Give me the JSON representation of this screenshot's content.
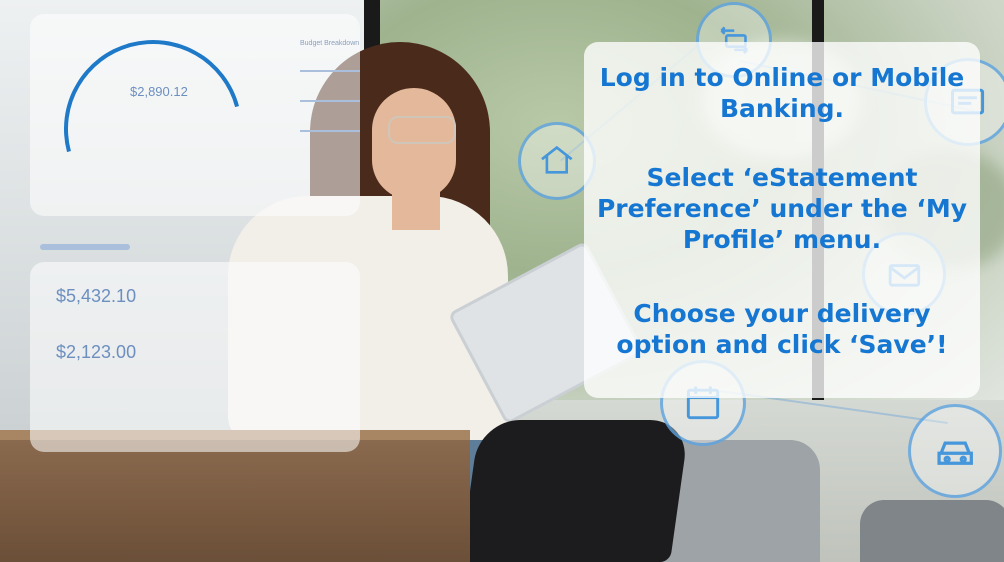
{
  "ui_overlay": {
    "balance_main": "$2,890.12",
    "balance_1": "$5,432.10",
    "balance_2": "$2,123.00",
    "budget_label": "Budget Breakdown"
  },
  "instructions": {
    "step1": "Log in to Online or Mobile Banking.",
    "step2": "Select ‘eStatement Preference’ under the ‘My Profile’ menu.",
    "step3": "Choose your delivery option and click ‘Save’!"
  },
  "colors": {
    "accent_blue": "#1677d2",
    "icon_ring": "#4696dc"
  },
  "icons": [
    "transfer-icon",
    "home-icon",
    "statement-icon",
    "mail-icon",
    "calendar-icon",
    "car-icon"
  ]
}
